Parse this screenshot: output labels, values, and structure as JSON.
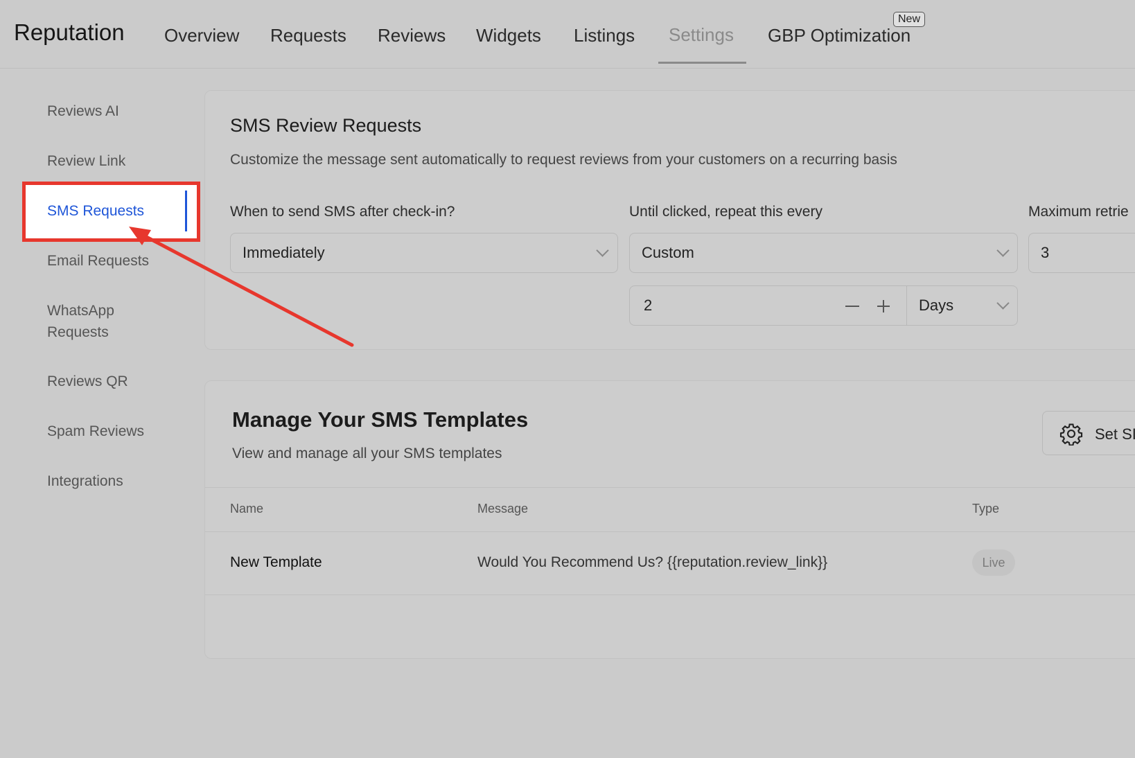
{
  "header": {
    "app_title": "Reputation",
    "tabs": [
      {
        "label": "Overview"
      },
      {
        "label": "Requests"
      },
      {
        "label": "Reviews"
      },
      {
        "label": "Widgets"
      },
      {
        "label": "Listings"
      },
      {
        "label": "Settings"
      },
      {
        "label": "GBP Optimization",
        "badge": "New"
      }
    ],
    "active_tab": "Settings"
  },
  "sidebar": {
    "items": [
      {
        "label": "Reviews AI"
      },
      {
        "label": "Review Link"
      },
      {
        "label": "SMS Requests"
      },
      {
        "label": "Email Requests"
      },
      {
        "label": "WhatsApp Requests"
      },
      {
        "label": "Reviews QR"
      },
      {
        "label": "Spam Reviews"
      },
      {
        "label": "Integrations"
      }
    ],
    "active_item": "SMS Requests",
    "active_color": "#1f56d8",
    "highlight_color": "#e7372d"
  },
  "sms_review_requests": {
    "title": "SMS Review Requests",
    "description": "Customize the message sent automatically to request reviews from your customers on a recurring basis",
    "when_to_send_label": "When to send SMS after check-in?",
    "when_to_send_value": "Immediately",
    "repeat_label": "Until clicked, repeat this every",
    "repeat_value": "Custom",
    "repeat_count": "2",
    "repeat_unit": "Days",
    "max_retries_label": "Maximum retrie",
    "max_retries_value": "3"
  },
  "templates": {
    "title": "Manage Your SMS Templates",
    "description": "View and manage all your SMS templates",
    "settings_button_label": "Set SI",
    "columns": [
      "Name",
      "Message",
      "Type"
    ],
    "rows": [
      {
        "name": "New Template",
        "message": "Would You Recommend Us? {{reputation.review_link}}",
        "type": "Live"
      }
    ]
  },
  "annotation_arrow_color": "#e7372d"
}
